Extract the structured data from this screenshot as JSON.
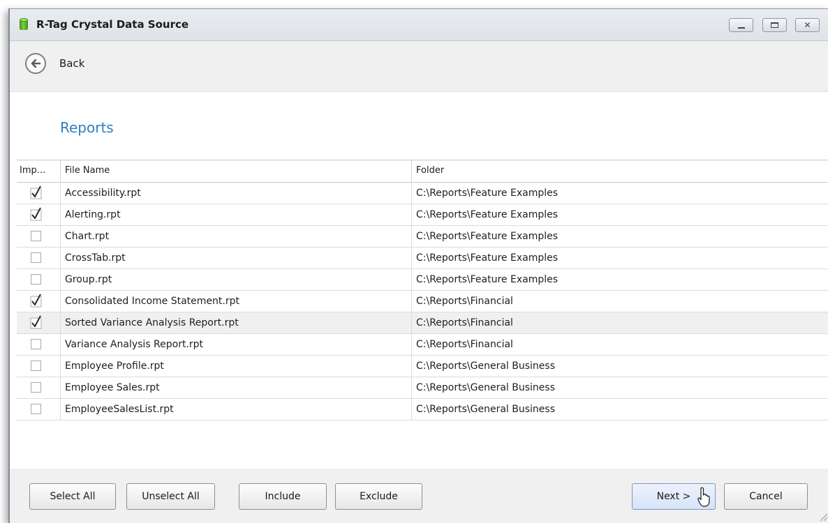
{
  "window": {
    "title": "R-Tag Crystal Data Source",
    "icon": "database-icon",
    "controls": [
      "minimize-icon",
      "maximize-icon",
      "close-icon"
    ]
  },
  "nav": {
    "back_label": "Back",
    "back_icon": "back-arrow-icon"
  },
  "page": {
    "heading": "Reports"
  },
  "grid": {
    "columns": [
      "Imp...",
      "File Name",
      "Folder"
    ],
    "selected_row_index": 6,
    "rows": [
      {
        "include": true,
        "file": "Accessibility.rpt",
        "folder": "C:\\Reports\\Feature Examples"
      },
      {
        "include": true,
        "file": "Alerting.rpt",
        "folder": "C:\\Reports\\Feature Examples"
      },
      {
        "include": false,
        "file": "Chart.rpt",
        "folder": "C:\\Reports\\Feature Examples"
      },
      {
        "include": false,
        "file": "CrossTab.rpt",
        "folder": "C:\\Reports\\Feature Examples"
      },
      {
        "include": false,
        "file": "Group.rpt",
        "folder": "C:\\Reports\\Feature Examples"
      },
      {
        "include": true,
        "file": "Consolidated Income Statement.rpt",
        "folder": "C:\\Reports\\Financial"
      },
      {
        "include": true,
        "file": "Sorted Variance Analysis Report.rpt",
        "folder": "C:\\Reports\\Financial"
      },
      {
        "include": false,
        "file": "Variance Analysis Report.rpt",
        "folder": "C:\\Reports\\Financial"
      },
      {
        "include": false,
        "file": "Employee Profile.rpt",
        "folder": "C:\\Reports\\General Business"
      },
      {
        "include": false,
        "file": "Employee Sales.rpt",
        "folder": "C:\\Reports\\General Business"
      },
      {
        "include": false,
        "file": "EmployeeSalesList.rpt",
        "folder": "C:\\Reports\\General Business"
      }
    ]
  },
  "footer": {
    "select_all": "Select All",
    "unselect_all": "Unselect All",
    "include": "Include",
    "exclude": "Exclude",
    "next": "Next >",
    "cancel": "Cancel"
  },
  "colors": {
    "accent": "#2e7fc0",
    "chrome": "#f0f0f0",
    "selected_row": "#eff0f2"
  }
}
